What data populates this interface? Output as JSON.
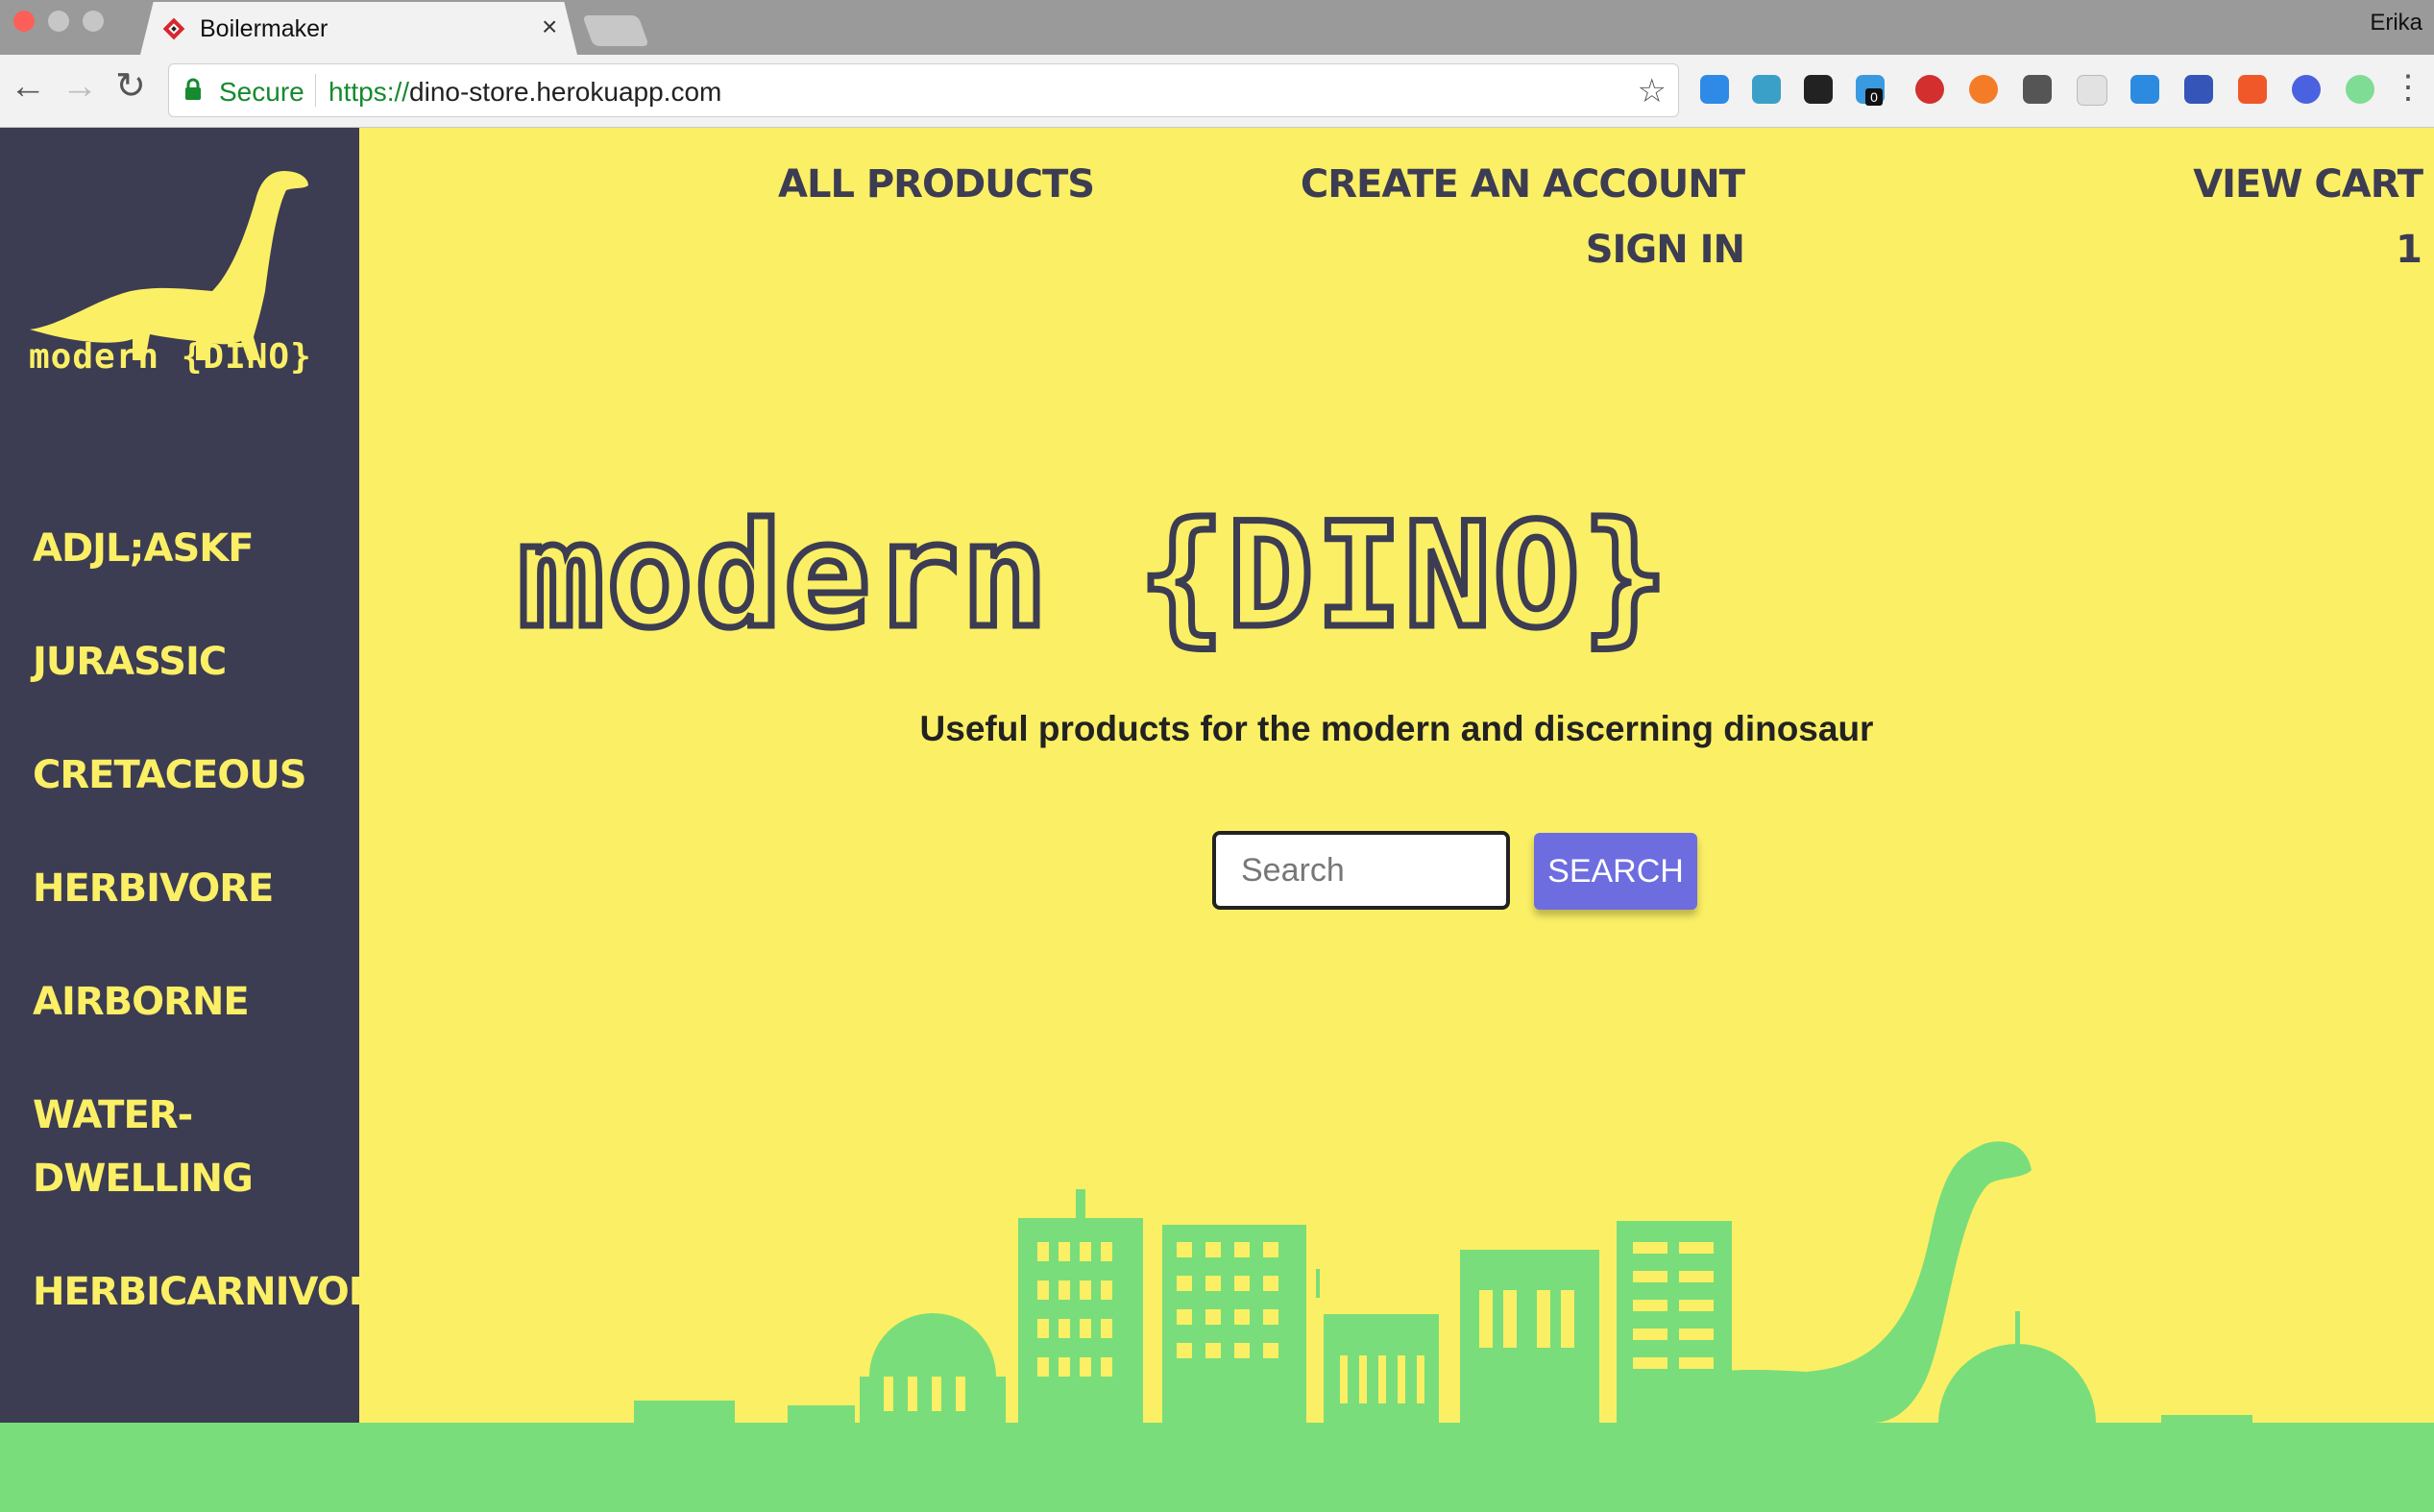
{
  "browser": {
    "tab_title": "Boilermaker",
    "profile_name": "Erika",
    "secure_label": "Secure",
    "url_scheme": "https://",
    "url_host": "dino-store.herokuapp.com",
    "extension_badge": "0"
  },
  "sidebar": {
    "logo_text": "modern {DINO}",
    "categories": [
      "ADJL;ASKF",
      "JURASSIC",
      "CRETACEOUS",
      "HERBIVORE",
      "AIRBORNE",
      "WATER-DWELLING",
      "HERBICARNIVORE"
    ]
  },
  "nav": {
    "all_products": "ALL PRODUCTS",
    "create_account": "CREATE AN ACCOUNT",
    "sign_in": "SIGN IN",
    "view_cart": "VIEW CART",
    "cart_count": "1"
  },
  "hero": {
    "title": "modern {DINO}",
    "tagline": "Useful products for the modern and discerning dinosaur"
  },
  "search": {
    "placeholder": "Search",
    "value": "",
    "button_label": "SEARCH"
  },
  "colors": {
    "page_background": "#fbef65",
    "sidebar_background": "#3c3c53",
    "accent_yellow": "#fbef65",
    "search_button": "#6d6de0",
    "skyline_green": "#79dd7b"
  },
  "icons": [
    "favicon-icon",
    "close-icon",
    "back-icon",
    "forward-icon",
    "reload-icon",
    "lock-icon",
    "star-icon",
    "menu-icon",
    "dinosaur-logo-icon"
  ]
}
